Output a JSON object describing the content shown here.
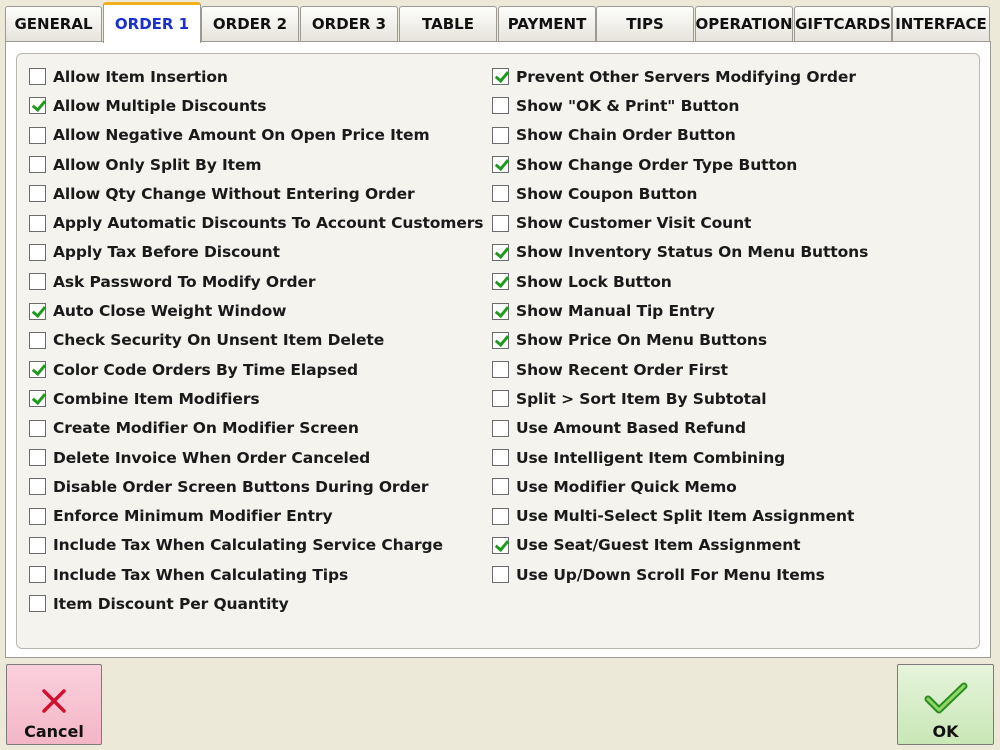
{
  "tabs": [
    {
      "label": "GENERAL",
      "active": false
    },
    {
      "label": "ORDER 1",
      "active": true
    },
    {
      "label": "ORDER 2",
      "active": false
    },
    {
      "label": "ORDER 3",
      "active": false
    },
    {
      "label": "TABLE",
      "active": false
    },
    {
      "label": "PAYMENT",
      "active": false
    },
    {
      "label": "TIPS",
      "active": false
    },
    {
      "label": "OPERATION",
      "active": false
    },
    {
      "label": "GIFTCARDS",
      "active": false
    },
    {
      "label": "INTERFACE",
      "active": false
    }
  ],
  "options_left": [
    {
      "label": "Allow Item Insertion",
      "checked": false
    },
    {
      "label": "Allow Multiple Discounts",
      "checked": true
    },
    {
      "label": "Allow Negative Amount On Open Price Item",
      "checked": false
    },
    {
      "label": "Allow Only Split By Item",
      "checked": false
    },
    {
      "label": "Allow Qty Change Without Entering Order",
      "checked": false
    },
    {
      "label": "Apply Automatic Discounts To Account Customers",
      "checked": false
    },
    {
      "label": "Apply Tax Before Discount",
      "checked": false
    },
    {
      "label": "Ask Password To Modify Order",
      "checked": false
    },
    {
      "label": "Auto Close Weight Window",
      "checked": true
    },
    {
      "label": "Check Security On Unsent Item Delete",
      "checked": false
    },
    {
      "label": "Color Code Orders By Time Elapsed",
      "checked": true
    },
    {
      "label": "Combine Item Modifiers",
      "checked": true
    },
    {
      "label": "Create Modifier On Modifier Screen",
      "checked": false
    },
    {
      "label": "Delete Invoice When Order Canceled",
      "checked": false
    },
    {
      "label": "Disable Order Screen Buttons During Order",
      "checked": false
    },
    {
      "label": "Enforce Minimum Modifier Entry",
      "checked": false
    },
    {
      "label": "Include Tax When Calculating Service Charge",
      "checked": false
    },
    {
      "label": "Include Tax When Calculating Tips",
      "checked": false
    },
    {
      "label": "Item Discount Per Quantity",
      "checked": false
    }
  ],
  "options_right": [
    {
      "label": "Prevent Other Servers Modifying Order",
      "checked": true
    },
    {
      "label": "Show \"OK & Print\" Button",
      "checked": false
    },
    {
      "label": "Show Chain Order Button",
      "checked": false
    },
    {
      "label": "Show Change Order Type Button",
      "checked": true
    },
    {
      "label": "Show Coupon Button",
      "checked": false
    },
    {
      "label": "Show Customer Visit Count",
      "checked": false
    },
    {
      "label": "Show Inventory Status On Menu Buttons",
      "checked": true
    },
    {
      "label": "Show Lock Button",
      "checked": true
    },
    {
      "label": "Show Manual Tip Entry",
      "checked": true
    },
    {
      "label": "Show Price On Menu Buttons",
      "checked": true
    },
    {
      "label": "Show Recent Order First",
      "checked": false
    },
    {
      "label": "Split > Sort Item By Subtotal",
      "checked": false
    },
    {
      "label": "Use Amount Based Refund",
      "checked": false
    },
    {
      "label": "Use Intelligent Item Combining",
      "checked": false
    },
    {
      "label": "Use Modifier Quick Memo",
      "checked": false
    },
    {
      "label": "Use Multi-Select Split Item Assignment",
      "checked": false
    },
    {
      "label": "Use Seat/Guest Item Assignment",
      "checked": true
    },
    {
      "label": "Use Up/Down Scroll For Menu Items",
      "checked": false
    }
  ],
  "footer": {
    "cancel_label": "Cancel",
    "cancel_icon": "x-icon",
    "ok_label": "OK",
    "ok_icon": "checkmark-icon"
  },
  "colors": {
    "active_tab_text": "#1a2fd0",
    "active_tab_accent": "#f0b020",
    "check_green": "#1f9a1f",
    "cancel_bg": "#f3b6c7",
    "ok_bg": "#c9e7b7"
  }
}
